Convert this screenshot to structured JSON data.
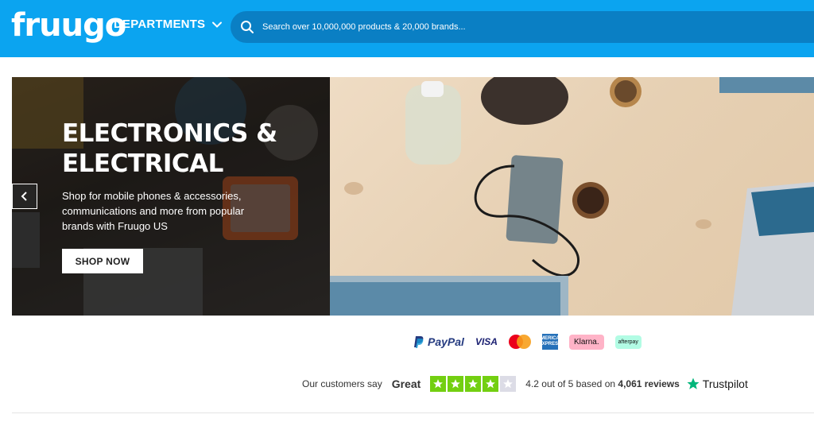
{
  "header": {
    "logo": "fruugo",
    "departments_label": "DEPARTMENTS",
    "search_placeholder": "Search over 10,000,000 products & 20,000 brands..."
  },
  "hero": {
    "title": "ELECTRONICS & ELECTRICAL",
    "description": "Shop for mobile phones & accessories, communications and more from popular brands with Fruugo US",
    "button_label": "SHOP NOW"
  },
  "payments": {
    "paypal": "PayPal",
    "visa": "VISA",
    "amex": "AMERICAN EXPRESS",
    "klarna": "Klarna.",
    "afterpay": "afterpay"
  },
  "trustpilot": {
    "intro": "Our customers say",
    "rating_word": "Great",
    "stars_filled": 4,
    "stars_total": 5,
    "score_text": "4.2 out of 5 based on",
    "reviews_count": "4,061 reviews",
    "brand": "Trustpilot"
  },
  "colors": {
    "header_bg": "#0ba4f0",
    "search_bg": "#0a7fc4",
    "star_green": "#73cf11",
    "star_grey": "#dcdce6"
  }
}
